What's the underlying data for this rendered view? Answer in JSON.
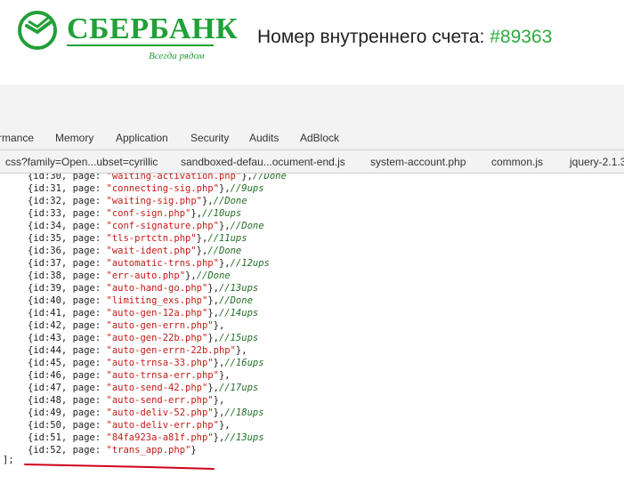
{
  "header": {
    "brand_name": "СБЕРБАНК",
    "slogan": "Всегда рядом",
    "account_label": "Номер внутреннего счета: ",
    "account_number": "#89363",
    "brand_color": "#21a038"
  },
  "panel_tabs": [
    "rmance",
    "Memory",
    "Application",
    "Security",
    "Audits",
    "AdBlock"
  ],
  "file_tabs": [
    "css?family=Open...ubset=cyrillic",
    "sandboxed-defau...ocument-end.js",
    "system-account.php",
    "common.js",
    "jquery-2.1.3"
  ],
  "code_lines": [
    {
      "id": "{id:30, page: ",
      "page": "\"waiting-activation.php\"",
      "end": "},",
      "comment": "//Done"
    },
    {
      "id": "{id:31, page: ",
      "page": "\"connecting-sig.php\"",
      "end": "},",
      "comment": "//9ups"
    },
    {
      "id": "{id:32, page: ",
      "page": "\"waiting-sig.php\"",
      "end": "},",
      "comment": "//Done"
    },
    {
      "id": "{id:33, page: ",
      "page": "\"conf-sign.php\"",
      "end": "},",
      "comment": "//10ups"
    },
    {
      "id": "{id:34, page: ",
      "page": "\"conf-signature.php\"",
      "end": "},",
      "comment": "//Done"
    },
    {
      "id": "{id:35, page: ",
      "page": "\"tls-prtctn.php\"",
      "end": "},",
      "comment": "//11ups"
    },
    {
      "id": "{id:36, page: ",
      "page": "\"wait-ident.php\"",
      "end": "},",
      "comment": "//Done"
    },
    {
      "id": "{id:37, page: ",
      "page": "\"automatic-trns.php\"",
      "end": "},",
      "comment": "//12ups"
    },
    {
      "id": "{id:38, page: ",
      "page": "\"err-auto.php\"",
      "end": "},",
      "comment": "//Done"
    },
    {
      "id": "{id:39, page: ",
      "page": "\"auto-hand-go.php\"",
      "end": "},",
      "comment": "//13ups"
    },
    {
      "id": "{id:40, page: ",
      "page": "\"limiting_exs.php\"",
      "end": "},",
      "comment": "//Done"
    },
    {
      "id": "{id:41, page: ",
      "page": "\"auto-gen-12a.php\"",
      "end": "},",
      "comment": "//14ups"
    },
    {
      "id": "{id:42, page: ",
      "page": "\"auto-gen-errn.php\"",
      "end": "},",
      "comment": ""
    },
    {
      "id": "{id:43, page: ",
      "page": "\"auto-gen-22b.php\"",
      "end": "},",
      "comment": "//15ups"
    },
    {
      "id": "{id:44, page: ",
      "page": "\"auto-gen-errn-22b.php\"",
      "end": "},",
      "comment": ""
    },
    {
      "id": "{id:45, page: ",
      "page": "\"auto-trnsa-33.php\"",
      "end": "},",
      "comment": "//16ups"
    },
    {
      "id": "{id:46, page: ",
      "page": "\"auto-trnsa-err.php\"",
      "end": "},",
      "comment": ""
    },
    {
      "id": "{id:47, page: ",
      "page": "\"auto-send-42.php\"",
      "end": "},",
      "comment": "//17ups"
    },
    {
      "id": "{id:48, page: ",
      "page": "\"auto-send-err.php\"",
      "end": "},",
      "comment": ""
    },
    {
      "id": "{id:49, page: ",
      "page": "\"auto-deliv-52.php\"",
      "end": "},",
      "comment": "//18ups"
    },
    {
      "id": "{id:50, page: ",
      "page": "\"auto-deliv-err.php\"",
      "end": "},",
      "comment": ""
    },
    {
      "id": "{id:51, page: ",
      "page": "\"84fa923a-a81f.php\"",
      "end": "},",
      "comment": "//13ups"
    },
    {
      "id": "{id:52, page: ",
      "page": "\"trans_app.php\"",
      "end": "}",
      "comment": ""
    }
  ],
  "closing": "];",
  "annotation_color": "#d0021b"
}
